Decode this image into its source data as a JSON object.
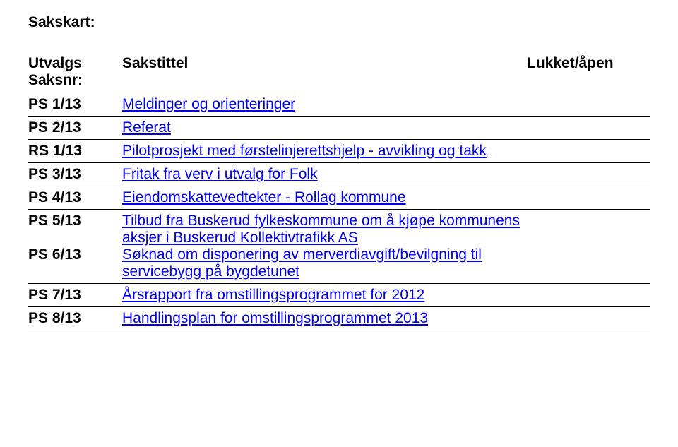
{
  "heading": "Sakskart:",
  "columns": {
    "id_line1": "Utvalgs",
    "id_line2": "Saksnr:",
    "title": "Sakstittel",
    "status": "Lukket/åpen"
  },
  "rows": [
    {
      "id": "PS 1/13",
      "title": "Meldinger og orienteringer"
    },
    {
      "id": "PS 2/13",
      "title": "Referat"
    },
    {
      "id": "RS 1/13",
      "title": "Pilotprosjekt med førstelinjerettshjelp - avvikling og takk"
    },
    {
      "id": "PS 3/13",
      "title": "Fritak fra verv i utvalg for Folk"
    },
    {
      "id": "PS 4/13",
      "title": "Eiendomskattevedtekter - Rollag kommune"
    },
    {
      "id": "PS 5/13",
      "title": "Tilbud fra Buskerud fylkeskommune om å kjøpe kommunens aksjer i Buskerud Kollektivtrafikk AS"
    },
    {
      "id": "PS 6/13",
      "title": "Søknad om disponering av merverdiavgift/bevilgning til servicebygg på bygdetunet"
    },
    {
      "id": "PS 7/13",
      "title": "Årsrapport fra omstillingsprogrammet for 2012"
    },
    {
      "id": "PS 8/13",
      "title": "Handlingsplan for omstillingsprogrammet 2013"
    }
  ]
}
